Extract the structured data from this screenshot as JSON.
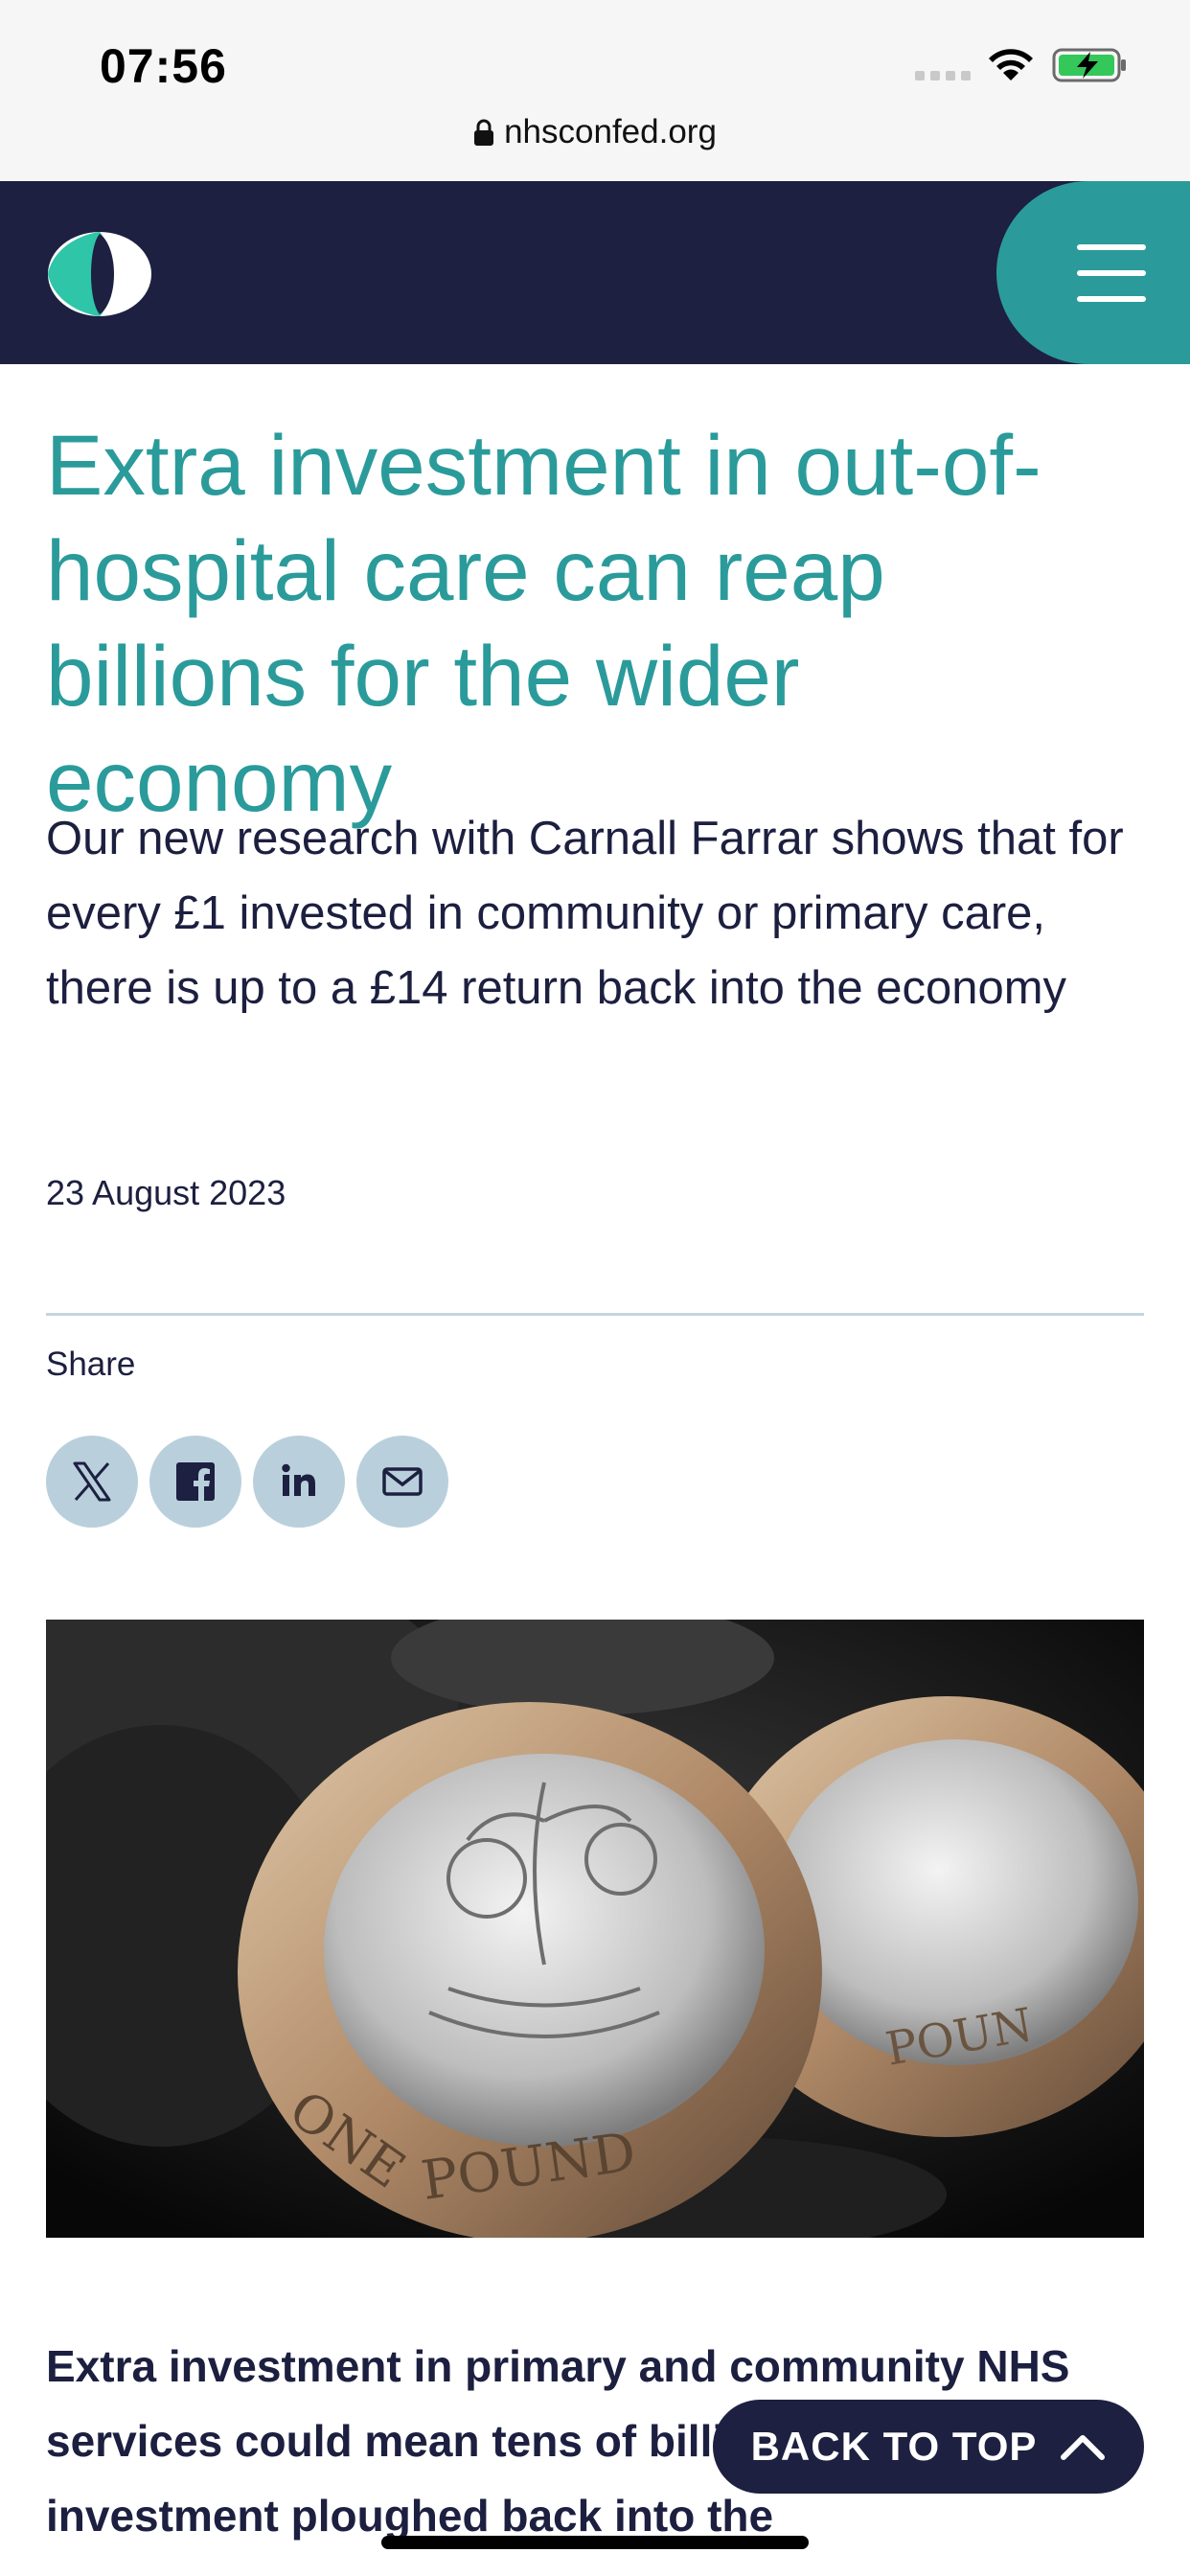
{
  "status_bar": {
    "time": "07:56"
  },
  "browser": {
    "url": "nhsconfed.org"
  },
  "header": {
    "logo_icon": "nhs-confed-logo-icon",
    "menu_icon": "hamburger-menu-icon"
  },
  "article": {
    "title": "Extra investment in out-of-hospital care can reap billions for the wider economy",
    "lede": "Our new research with Carnall Farrar shows that for every £1 invested in community or primary care, there is up to a £14 return back into the economy",
    "date": "23 August 2023",
    "share_label": "Share",
    "share_icons": [
      "x-icon",
      "facebook-icon",
      "linkedin-icon",
      "email-icon"
    ],
    "image_icon": "pound-coins-image",
    "body_visible": "Extra investment in primary and community NHS services could mean tens of billions of additional investment ploughed back into the"
  },
  "back_to_top": {
    "label": "BACK TO TOP",
    "icon": "chevron-up-icon"
  },
  "colors": {
    "brand_navy": "#1d2040",
    "brand_teal": "#2a9b9a",
    "share_bg": "#b9d0dc"
  }
}
